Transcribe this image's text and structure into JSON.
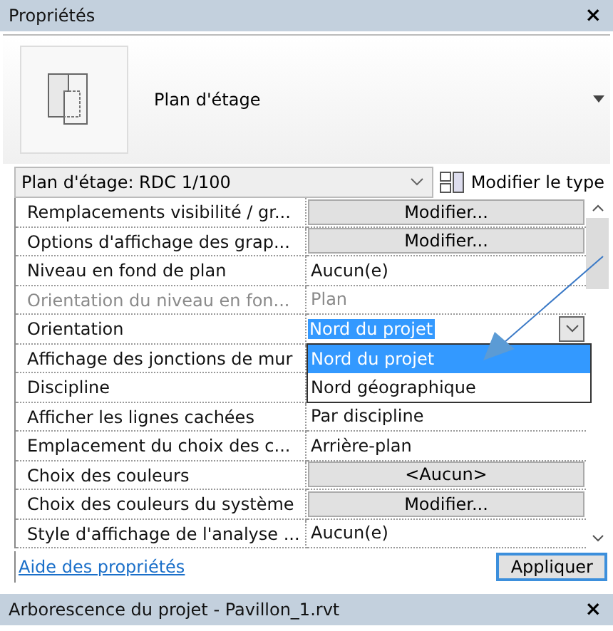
{
  "properties_panel": {
    "title": "Propriétés",
    "close": "×",
    "type_name": "Plan d'étage",
    "type_selector": "Plan d'étage: RDC 1/100",
    "edit_type": "Modifier le type",
    "rows": [
      {
        "label": "Remplacements visibilité / gr...",
        "kind": "button",
        "value": "Modifier..."
      },
      {
        "label": "Options d'affichage des grap...",
        "kind": "button",
        "value": "Modifier..."
      },
      {
        "label": "Niveau en fond de plan",
        "kind": "text",
        "value": "Aucun(e)"
      },
      {
        "label": "Orientation du niveau en fon...",
        "kind": "disabled",
        "value": "Plan"
      },
      {
        "label": "Orientation",
        "kind": "combo",
        "value": "Nord du projet",
        "expanded": true,
        "options": [
          {
            "label": "Nord du projet",
            "selected": true
          },
          {
            "label": "Nord géographique",
            "selected": false
          }
        ]
      },
      {
        "label": "Affichage des jonctions de mur",
        "kind": "hidden"
      },
      {
        "label": "Discipline",
        "kind": "hidden"
      },
      {
        "label": "Afficher les lignes cachées",
        "kind": "text",
        "value": "Par discipline"
      },
      {
        "label": "Emplacement du choix des c...",
        "kind": "text",
        "value": "Arrière-plan"
      },
      {
        "label": "Choix des couleurs",
        "kind": "button",
        "value": "<Aucun>"
      },
      {
        "label": "Choix des couleurs du système",
        "kind": "button",
        "value": "Modifier..."
      },
      {
        "label": "Style d'affichage de l'analyse ...",
        "kind": "text",
        "value": "Aucun(e)"
      }
    ],
    "help_link": "Aide des propriétés",
    "apply": "Appliquer"
  },
  "project_browser": {
    "title": "Arborescence du projet - Pavillon_1.rvt",
    "close": "×"
  }
}
